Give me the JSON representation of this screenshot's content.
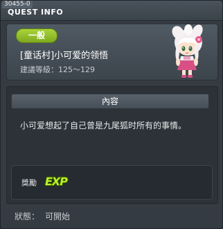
{
  "window": {
    "quest_id": "30455-0",
    "title": "QUEST INFO"
  },
  "header": {
    "category": "一般",
    "quest_title": "[童话村]小可爱的领悟",
    "level_range": "建議等級：125～129"
  },
  "content": {
    "section_label": "內容",
    "description": "小可爱想起了自己曾是九尾狐时所有的事情。"
  },
  "reward": {
    "label": "獎勵",
    "exp_icon_text": "EXP"
  },
  "status": {
    "label": "狀態：",
    "value": "可開始"
  },
  "colors": {
    "category_badge": "#8fbc23",
    "exp_icon": "#b9ef2a",
    "panel_bg": "#353b42"
  },
  "icons": {
    "npc": "npc-portrait-icon",
    "exp": "exp-icon"
  }
}
